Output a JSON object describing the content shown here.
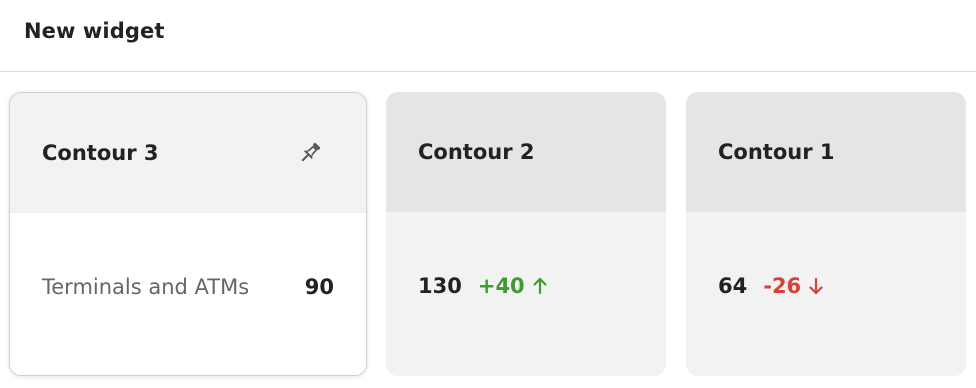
{
  "header": {
    "title": "New widget"
  },
  "cards": [
    {
      "title": "Contour 3",
      "pinned": true,
      "icon": "pin-icon",
      "row": {
        "label": "Terminals and ATMs",
        "value": "90"
      }
    },
    {
      "title": "Contour 2",
      "value": "130",
      "delta": "+40",
      "trend": "up",
      "trend_icon": "arrow-up-icon",
      "delta_color": "#3f9b2f"
    },
    {
      "title": "Contour 1",
      "value": "64",
      "delta": "-26",
      "trend": "down",
      "trend_icon": "arrow-down-icon",
      "delta_color": "#d8403a"
    }
  ],
  "colors": {
    "selected_card_head": "#f2f2f2",
    "card_head": "#e5e5e5",
    "card_body": "#f2f2f2",
    "positive": "#3f9b2f",
    "negative": "#d8403a"
  }
}
